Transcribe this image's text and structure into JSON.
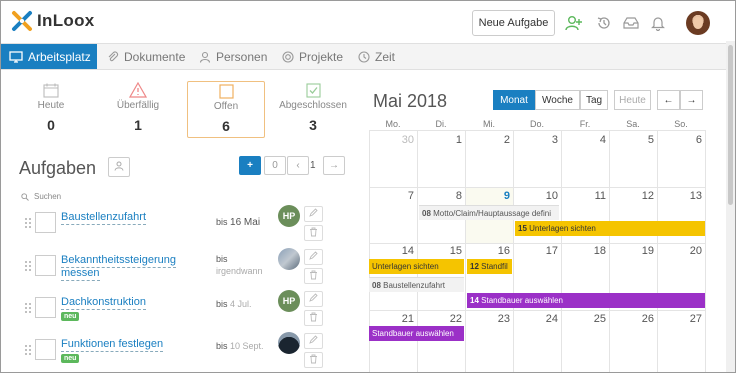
{
  "app": {
    "name": "InLoox",
    "new_task_label": "Neue Aufgabe"
  },
  "colors": {
    "accent": "#1a7fc1",
    "new_badge": "#5cb85c",
    "event_yellow": "#f5c400",
    "event_purple": "#9b30c7"
  },
  "nav": {
    "items": [
      {
        "label": "Arbeitsplatz",
        "icon": "monitor-icon",
        "active": true
      },
      {
        "label": "Dokumente",
        "icon": "paperclip-icon",
        "active": false
      },
      {
        "label": "Personen",
        "icon": "person-icon",
        "active": false
      },
      {
        "label": "Projekte",
        "icon": "target-icon",
        "active": false
      },
      {
        "label": "Zeit",
        "icon": "clock-icon",
        "active": false
      }
    ]
  },
  "stats": [
    {
      "label": "Heute",
      "value": "0",
      "icon": "calendar-icon"
    },
    {
      "label": "Überfällig",
      "value": "1",
      "icon": "warning-icon"
    },
    {
      "label": "Offen",
      "value": "6",
      "icon": "square-icon"
    },
    {
      "label": "Abgeschlossen",
      "value": "3",
      "icon": "checkbox-icon"
    }
  ],
  "tasks_panel": {
    "title": "Aufgaben",
    "add_label": "+",
    "zero_label": "0",
    "page": "1",
    "search_placeholder": "Suchen"
  },
  "tasks": [
    {
      "title": "Baustellenzufahrt",
      "title2": "",
      "badge": "",
      "due_prefix": "bis",
      "due_date": "16 Mai",
      "due_muted": false,
      "assignee": "HP",
      "assignee_color": "#6b8e5a"
    },
    {
      "title": "Bekanntheitssteigerung",
      "title2": "messen",
      "badge": "",
      "due_prefix": "bis",
      "due_date": "irgendwann",
      "due_muted": true,
      "assignee": "",
      "assignee_color": "#7a8fa0"
    },
    {
      "title": "Dachkonstruktion",
      "title2": "",
      "badge": "neu",
      "due_prefix": "bis",
      "due_date": "4 Jul.",
      "due_muted": true,
      "assignee": "HP",
      "assignee_color": "#6b8e5a"
    },
    {
      "title": "Funktionen festlegen",
      "title2": "",
      "badge": "neu",
      "due_prefix": "bis",
      "due_date": "10 Sept.",
      "due_muted": true,
      "assignee": "",
      "assignee_color": "#2a3a4a"
    }
  ],
  "calendar": {
    "title": "Mai 2018",
    "views": [
      "Monat",
      "Woche",
      "Tag"
    ],
    "today_label": "Heute",
    "weekdays": [
      "Mo.",
      "Di.",
      "Mi.",
      "Do.",
      "Fr.",
      "Sa.",
      "So."
    ],
    "weeks": [
      [
        "30",
        "1",
        "2",
        "3",
        "4",
        "5",
        "6"
      ],
      [
        "7",
        "8",
        "9",
        "10",
        "11",
        "12",
        "13"
      ],
      [
        "14",
        "15",
        "16",
        "17",
        "18",
        "19",
        "20"
      ],
      [
        "21",
        "22",
        "23",
        "24",
        "25",
        "26",
        "27"
      ]
    ],
    "events": [
      {
        "time": "08",
        "title": "Motto/Claim/Hauptaussage defini",
        "color": "gray"
      },
      {
        "time": "15",
        "title": "Unterlagen sichten",
        "color": "yellow"
      },
      {
        "time": "",
        "title": "Unterlagen sichten",
        "color": "yellow"
      },
      {
        "time": "12",
        "title": "Standfil",
        "color": "yellow"
      },
      {
        "time": "08",
        "title": "Baustellenzufahrt",
        "color": "gray"
      },
      {
        "time": "14",
        "title": "Standbauer auswählen",
        "color": "purple"
      },
      {
        "time": "",
        "title": "Standbauer auswählen",
        "color": "purple"
      }
    ]
  }
}
